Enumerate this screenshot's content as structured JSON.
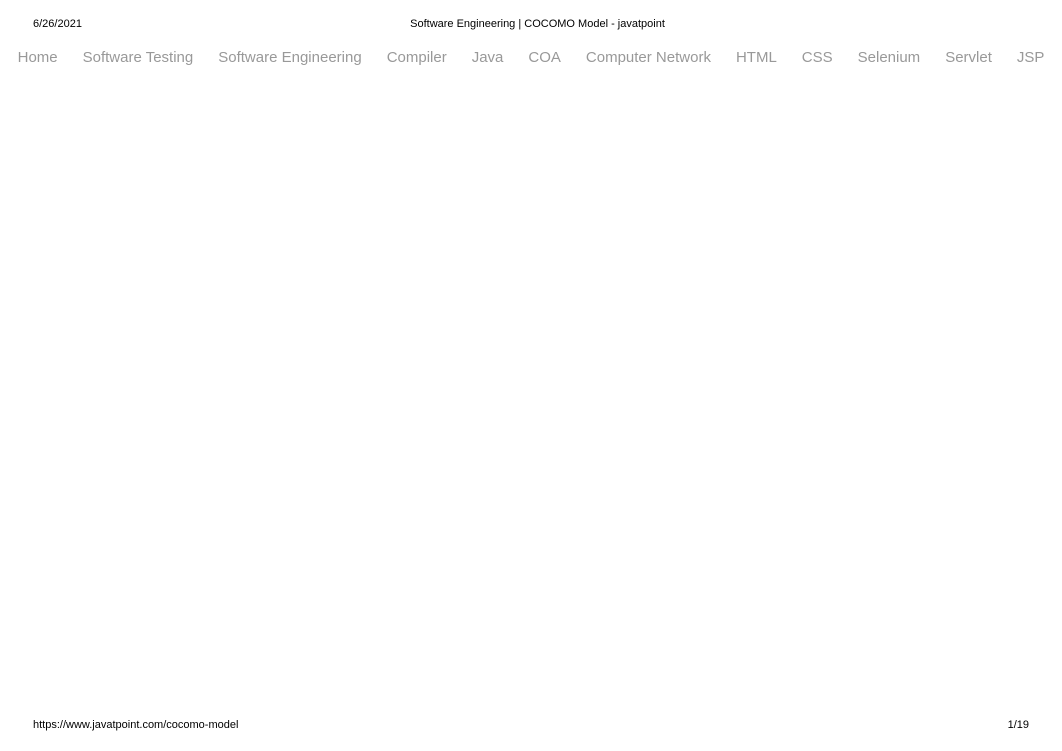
{
  "header": {
    "date": "6/26/2021",
    "title": "Software Engineering | COCOMO Model - javatpoint"
  },
  "nav": {
    "items": [
      {
        "label": "Home"
      },
      {
        "label": "Software Testing"
      },
      {
        "label": "Software Engineering"
      },
      {
        "label": "Compiler"
      },
      {
        "label": "Java"
      },
      {
        "label": "COA"
      },
      {
        "label": "Computer Network"
      },
      {
        "label": "HTML"
      },
      {
        "label": "CSS"
      },
      {
        "label": "Selenium"
      },
      {
        "label": "Servlet"
      },
      {
        "label": "JSP"
      }
    ]
  },
  "footer": {
    "url": "https://www.javatpoint.com/cocomo-model",
    "page": "1/19"
  }
}
